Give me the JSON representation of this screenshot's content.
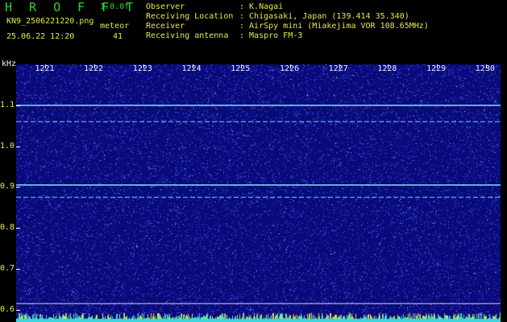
{
  "header": {
    "app_title": "H R O F F T",
    "app_version": "1.0.0f",
    "file_name": "KN9_2506221220.png",
    "mode_label": "meteor",
    "datetime": "25.06.22 12:20",
    "count_value": "41"
  },
  "metadata": [
    {
      "label": "Observer",
      "value": ": K.Nagai"
    },
    {
      "label": "Receiving Location",
      "value": ": Chigasaki, Japan (139.414 35.340)"
    },
    {
      "label": "Receiver",
      "value": ": AirSpy mini (Miakejima VOR 108.65MHz)"
    },
    {
      "label": "Receiving antenna",
      "value": ": Maspro FM-3"
    }
  ],
  "colors": {
    "background": "#000000",
    "plot_base": "#0a0a7a",
    "noise": "#3c54ff",
    "signal_line": "#6fd8e8",
    "label_green": "#2bd62b",
    "label_yellow": "#e8e84a"
  },
  "chart_data": {
    "type": "heatmap",
    "ylabel": "kHz",
    "y_ticks": [
      "1.1",
      "1.0",
      "0.9",
      "0.8",
      "0.7",
      "0.6"
    ],
    "x_ticks": [
      "1221",
      "1222",
      "1223",
      "1224",
      "1225",
      "1226",
      "1227",
      "1228",
      "1229",
      "1230"
    ],
    "y_range": [
      0.57,
      1.2
    ],
    "x_range": [
      1220.4,
      1230.3
    ],
    "horizontal_signals_khz": [
      1.1,
      1.06,
      0.905,
      0.875,
      0.615
    ],
    "grid": false
  }
}
